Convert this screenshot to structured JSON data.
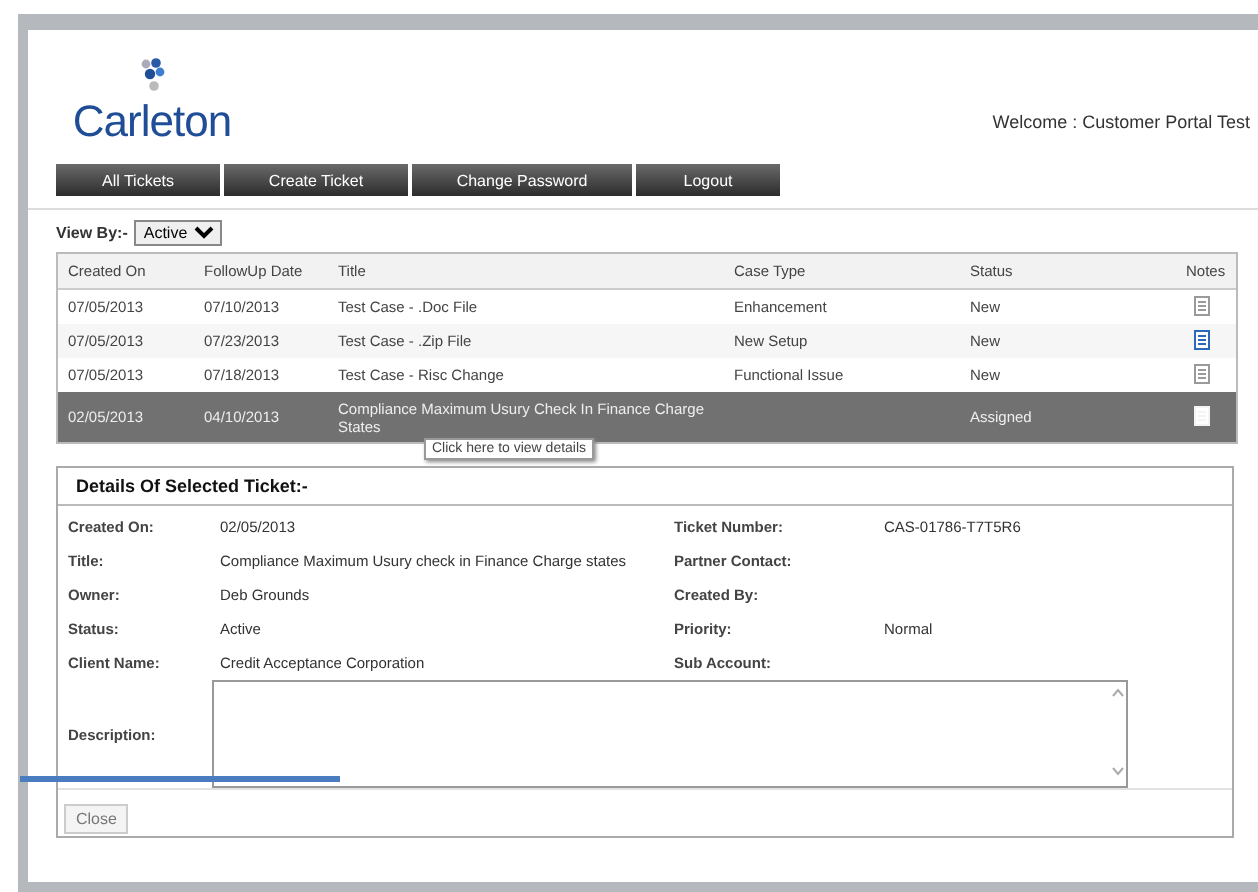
{
  "logo": {
    "text": "Carleton"
  },
  "welcome": "Welcome : Customer Portal Test",
  "nav": [
    "All Tickets",
    "Create Ticket",
    "Change Password",
    "Logout"
  ],
  "view_by": {
    "label": "View By:-",
    "value": "Active"
  },
  "table": {
    "columns": [
      "Created On",
      "FollowUp Date",
      "Title",
      "Case Type",
      "Status",
      "Notes"
    ],
    "rows": [
      {
        "created_on": "07/05/2013",
        "followup_date": "07/10/2013",
        "title": "Test Case - .Doc File",
        "case_type": "Enhancement",
        "status": "New",
        "color": "#9a9a9a",
        "selected": false
      },
      {
        "created_on": "07/05/2013",
        "followup_date": "07/23/2013",
        "title": "Test Case - .Zip File",
        "case_type": "New Setup",
        "status": "New",
        "color": "#2a6ab8",
        "selected": false
      },
      {
        "created_on": "07/05/2013",
        "followup_date": "07/18/2013",
        "title": "Test Case - Risc Change",
        "case_type": "Functional Issue",
        "status": "New",
        "color": "#9a9a9a",
        "selected": false
      },
      {
        "created_on": "02/05/2013",
        "followup_date": "04/10/2013",
        "title": "Compliance Maximum Usury Check In Finance Charge States",
        "case_type": "",
        "status": "Assigned",
        "color": "#f4f4f4",
        "selected": true
      }
    ]
  },
  "tooltip": "Click here to view details",
  "details": {
    "heading": "Details Of Selected Ticket:-",
    "fields": [
      {
        "label": "Created On:",
        "value": "02/05/2013"
      },
      {
        "label": "Ticket Number:",
        "value": "CAS-01786-T7T5R6"
      },
      {
        "label": "Title:",
        "value": "Compliance Maximum Usury check in Finance Charge states"
      },
      {
        "label": "Partner Contact:"
      },
      {
        "label": "Owner:",
        "value": "Deb Grounds"
      },
      {
        "label": "Created By:"
      },
      {
        "label": "Status:",
        "value": "Active"
      },
      {
        "label": "Priority:",
        "value": "Normal"
      },
      {
        "label": "Client Name:",
        "value": "Credit Acceptance Corporation"
      },
      {
        "label": "Sub Account:"
      }
    ],
    "description_label": "Description:",
    "close_button": "Close"
  }
}
